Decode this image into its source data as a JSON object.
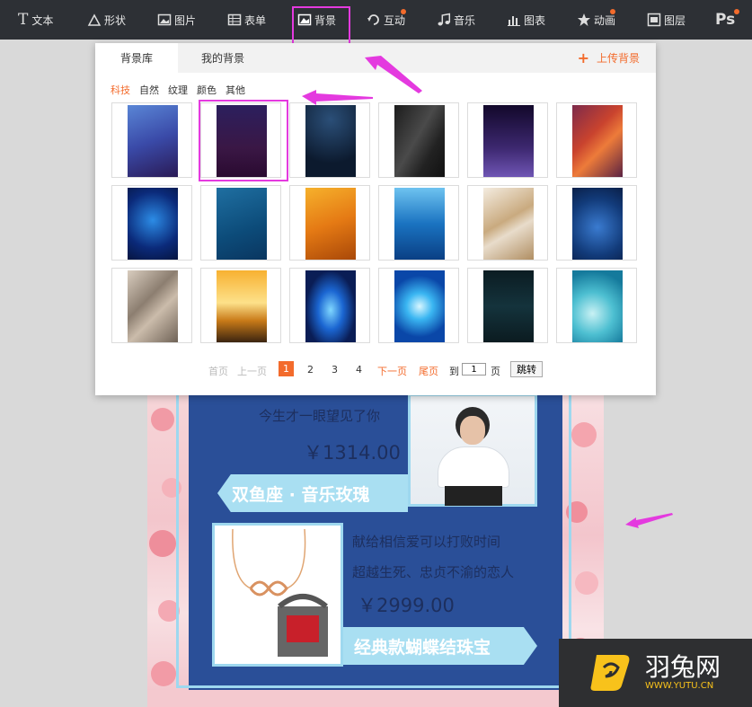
{
  "toolbar": {
    "items": [
      {
        "label": "文本",
        "icon": "text-icon"
      },
      {
        "label": "形状",
        "icon": "shape-icon"
      },
      {
        "label": "图片",
        "icon": "image-icon"
      },
      {
        "label": "表单",
        "icon": "form-icon"
      },
      {
        "label": "背景",
        "icon": "background-icon"
      },
      {
        "label": "互动",
        "icon": "interact-icon"
      },
      {
        "label": "音乐",
        "icon": "music-icon"
      },
      {
        "label": "图表",
        "icon": "chart-icon"
      },
      {
        "label": "动画",
        "icon": "animation-icon"
      },
      {
        "label": "图层",
        "icon": "layer-icon"
      }
    ],
    "ps_label": "Ps",
    "text_glyph": "T"
  },
  "dialog": {
    "tabs": [
      "背景库",
      "我的背景"
    ],
    "upload_label": "上传背景",
    "upload_plus": "+",
    "categories": [
      "科技",
      "自然",
      "纹理",
      "颜色",
      "其他"
    ],
    "pager": {
      "first": "首页",
      "prev": "上一页",
      "pages": [
        "1",
        "2",
        "3",
        "4"
      ],
      "next": "下一页",
      "last": "尾页",
      "goto_prefix": "到",
      "goto_value": "1",
      "goto_suffix": "页",
      "jump": "跳转"
    }
  },
  "poster": {
    "line1": "今生才一眼望见了你",
    "price1": "￥1314.00",
    "ribbon1": "双鱼座 · 音乐玫瑰",
    "line2": "献给相信爱可以打败时间",
    "line3": "超越生死、忠贞不渝的恋人",
    "price2": "￥2999.00",
    "ribbon2": "经典款蝴蝶结珠宝"
  },
  "watermark": {
    "name": "羽兔网",
    "url": "WWW.YUTU.CN"
  },
  "colors": {
    "accent": "#f36b2c",
    "highlight": "#e43adf",
    "toolbar_bg": "#2d3035"
  }
}
